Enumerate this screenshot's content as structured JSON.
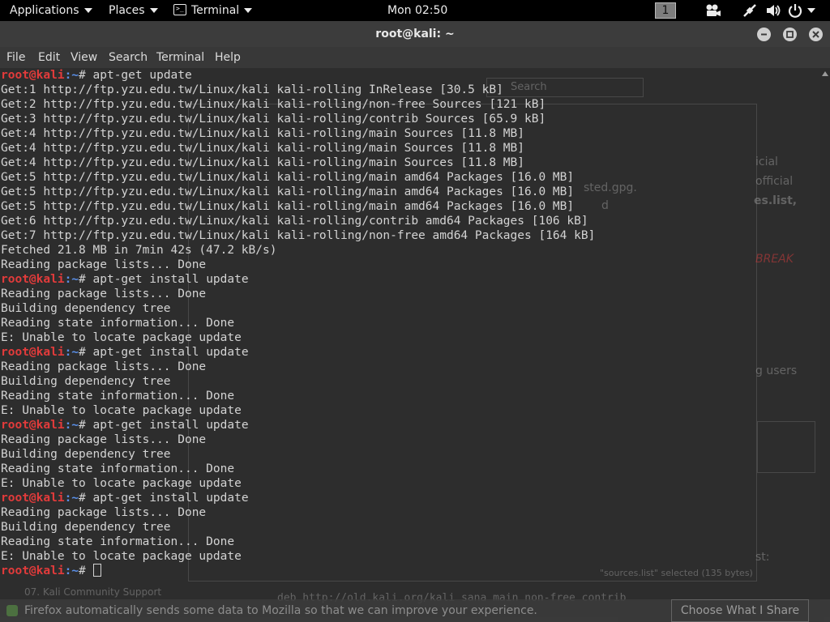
{
  "topbar": {
    "applications": "Applications",
    "places": "Places",
    "terminal_app": "Terminal",
    "clock": "Mon 02:50",
    "workspace": "1"
  },
  "window": {
    "title": "root@kali: ~"
  },
  "menubar": {
    "items": [
      "File",
      "Edit",
      "View",
      "Search",
      "Terminal",
      "Help"
    ]
  },
  "terminal": {
    "prompt_user": "root@kali",
    "prompt_path": ":~",
    "prompt_symbol": "# ",
    "lines": [
      {
        "kind": "prompt",
        "cmd": "apt-get update"
      },
      {
        "kind": "out",
        "text": "Get:1 http://ftp.yzu.edu.tw/Linux/kali kali-rolling InRelease [30.5 kB]"
      },
      {
        "kind": "out",
        "text": "Get:2 http://ftp.yzu.edu.tw/Linux/kali kali-rolling/non-free Sources [121 kB]"
      },
      {
        "kind": "out",
        "text": "Get:3 http://ftp.yzu.edu.tw/Linux/kali kali-rolling/contrib Sources [65.9 kB]"
      },
      {
        "kind": "out",
        "text": "Get:4 http://ftp.yzu.edu.tw/Linux/kali kali-rolling/main Sources [11.8 MB]"
      },
      {
        "kind": "out",
        "text": "Get:4 http://ftp.yzu.edu.tw/Linux/kali kali-rolling/main Sources [11.8 MB]"
      },
      {
        "kind": "out",
        "text": "Get:4 http://ftp.yzu.edu.tw/Linux/kali kali-rolling/main Sources [11.8 MB]"
      },
      {
        "kind": "out",
        "text": "Get:5 http://ftp.yzu.edu.tw/Linux/kali kali-rolling/main amd64 Packages [16.0 MB]"
      },
      {
        "kind": "out",
        "text": "Get:5 http://ftp.yzu.edu.tw/Linux/kali kali-rolling/main amd64 Packages [16.0 MB]"
      },
      {
        "kind": "out",
        "text": "Get:5 http://ftp.yzu.edu.tw/Linux/kali kali-rolling/main amd64 Packages [16.0 MB]"
      },
      {
        "kind": "out",
        "text": "Get:6 http://ftp.yzu.edu.tw/Linux/kali kali-rolling/contrib amd64 Packages [106 kB]"
      },
      {
        "kind": "out",
        "text": "Get:7 http://ftp.yzu.edu.tw/Linux/kali kali-rolling/non-free amd64 Packages [164 kB]"
      },
      {
        "kind": "out",
        "text": "Fetched 21.8 MB in 7min 42s (47.2 kB/s)"
      },
      {
        "kind": "out",
        "text": "Reading package lists... Done"
      },
      {
        "kind": "prompt",
        "cmd": "apt-get install update"
      },
      {
        "kind": "out",
        "text": "Reading package lists... Done"
      },
      {
        "kind": "out",
        "text": "Building dependency tree"
      },
      {
        "kind": "out",
        "text": "Reading state information... Done"
      },
      {
        "kind": "out",
        "text": "E: Unable to locate package update"
      },
      {
        "kind": "prompt",
        "cmd": "apt-get install update"
      },
      {
        "kind": "out",
        "text": "Reading package lists... Done"
      },
      {
        "kind": "out",
        "text": "Building dependency tree"
      },
      {
        "kind": "out",
        "text": "Reading state information... Done"
      },
      {
        "kind": "out",
        "text": "E: Unable to locate package update"
      },
      {
        "kind": "prompt",
        "cmd": "apt-get install update"
      },
      {
        "kind": "out",
        "text": "Reading package lists... Done"
      },
      {
        "kind": "out",
        "text": "Building dependency tree"
      },
      {
        "kind": "out",
        "text": "Reading state information... Done"
      },
      {
        "kind": "out",
        "text": "E: Unable to locate package update"
      },
      {
        "kind": "prompt",
        "cmd": "apt-get install update"
      },
      {
        "kind": "out",
        "text": "Reading package lists... Done"
      },
      {
        "kind": "out",
        "text": "Building dependency tree"
      },
      {
        "kind": "out",
        "text": "Reading state information... Done"
      },
      {
        "kind": "out",
        "text": "E: Unable to locate package update"
      },
      {
        "kind": "prompt",
        "cmd": "",
        "cursor": true
      }
    ]
  },
  "background": {
    "search_placeholder": "Search",
    "file_label": "sted.gpg.",
    "file_label2": "d",
    "side_text1": "icial",
    "side_text2": "official",
    "side_text3": "es.list,",
    "side_text4": "BREAK",
    "side_text5": "g users",
    "side_text6": "st:",
    "status": "\"sources.list\" selected  (135 bytes)",
    "deb_line": "deb http://old.kali.org/kali sana main non-free contrib",
    "community": "07. Kali Community Support"
  },
  "firefox_bar": {
    "message": "Firefox automatically sends some data to Mozilla so that we can improve your experience.",
    "button": "Choose What I Share"
  },
  "colors": {
    "prompt_user": "#e23b3b",
    "prompt_path": "#5a8fe8",
    "terminal_bg": "#2e2e2e",
    "text": "#d3d3d3"
  }
}
